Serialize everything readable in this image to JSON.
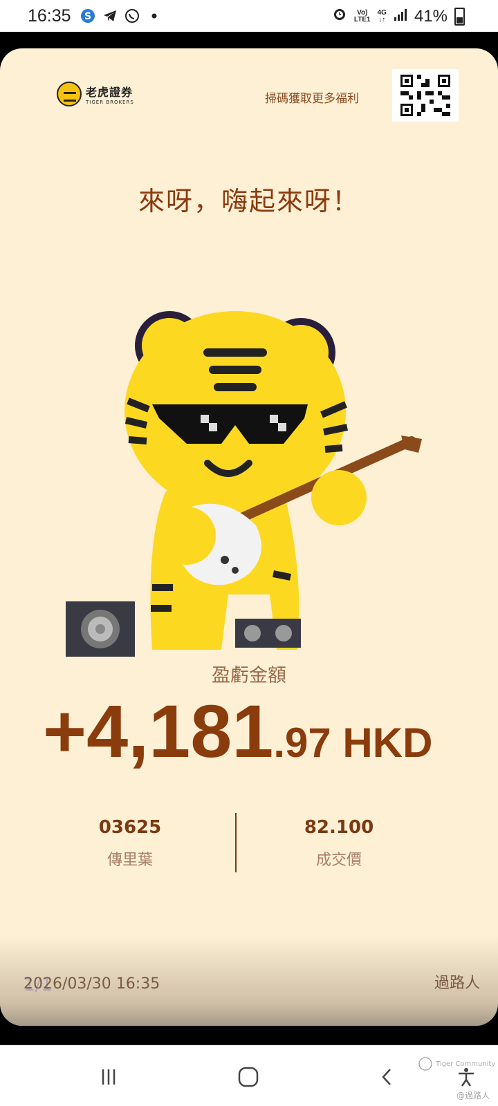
{
  "status_bar": {
    "time": "16:35",
    "network_top": "Vo)",
    "network_bottom": "LTE1",
    "signal_type": "4G",
    "battery": "41%",
    "icons": [
      "skype-icon",
      "telegram-icon",
      "whatsapp-icon",
      "dot-icon",
      "alarm-icon",
      "signal-icon",
      "battery-icon"
    ]
  },
  "card": {
    "brand_cn": "老虎證券",
    "brand_en": "TIGER BROKERS",
    "scan_text": "掃碼獲取更多福利",
    "headline": "來呀，嗨起來呀！",
    "pl_label": "盈虧金額",
    "amount_main": "+4,181",
    "amount_tail": ".97 HKD",
    "stock_code": "03625",
    "stock_name": "傳里葉",
    "price": "82.100",
    "price_label": "成交價",
    "date": "2026/03/30 16:35",
    "page_indicator": "1/1",
    "username": "過路人"
  },
  "nav": {
    "watermark": "Tiger Community",
    "watermark_user": "@過路人"
  },
  "colors": {
    "card_bg": "#fdf0d5",
    "accent_brown": "#8a3c0c",
    "tiger_yellow": "#fdd820"
  }
}
